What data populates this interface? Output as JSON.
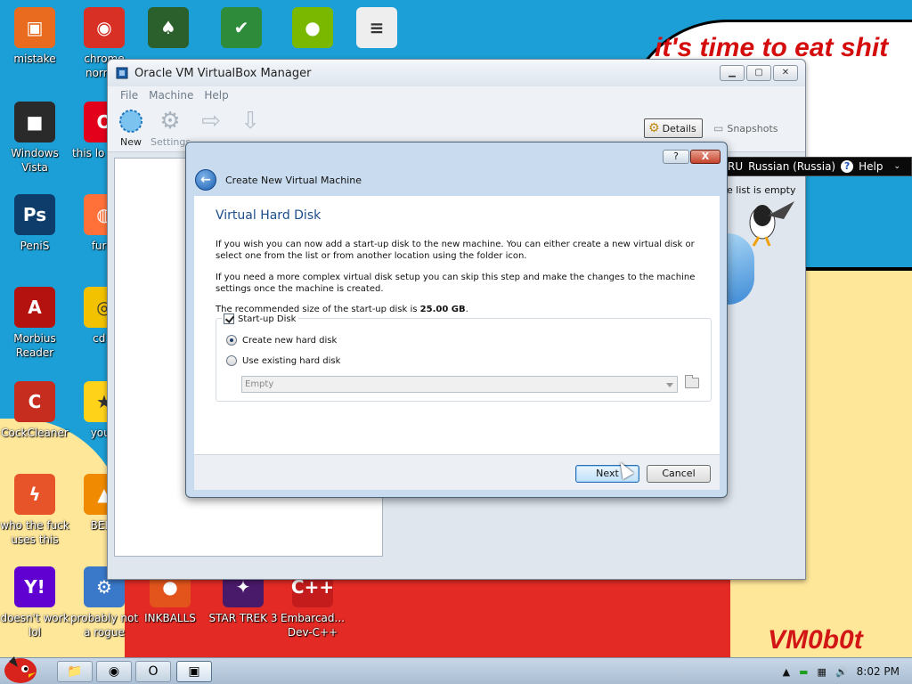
{
  "wallpaper": {
    "speech_text": "it's time to eat shit\nd chew\nm",
    "signature": "VM0b0t"
  },
  "desktop_icons": [
    {
      "name": "desktop-icon-mistake",
      "label": "mistake",
      "icon": "monitor-icon",
      "color": "#e86b1f"
    },
    {
      "name": "desktop-icon-chrome",
      "label": "chrome normal",
      "icon": "chrome-icon",
      "color": "#d93025"
    },
    {
      "name": "desktop-icon-solitaire",
      "label": "",
      "icon": "cards-icon",
      "color": "#2b5f2b"
    },
    {
      "name": "desktop-icon-shield",
      "label": "",
      "icon": "shield-icon",
      "color": "#2e8b3a"
    },
    {
      "name": "desktop-icon-angry-birds",
      "label": "",
      "icon": "pig-icon",
      "color": "#7ab800"
    },
    {
      "name": "desktop-icon-document",
      "label": "",
      "icon": "document-icon",
      "color": "#eeeeee"
    },
    {
      "name": "desktop-icon-windows-vista",
      "label": "Windows Vista",
      "icon": "trash-icon",
      "color": "#2a2a2a"
    },
    {
      "name": "desktop-icon-opera",
      "label": "this lo like a",
      "icon": "opera-icon",
      "color": "#e3001b"
    },
    {
      "name": "desktop-icon-photoshop",
      "label": "PeniS",
      "icon": "photoshop-icon",
      "color": "#0e3d6b"
    },
    {
      "name": "desktop-icon-firefox",
      "label": "furry",
      "icon": "firefox-icon",
      "color": "#ff7139"
    },
    {
      "name": "desktop-icon-reader",
      "label": "Morbius Reader",
      "icon": "pdf-icon",
      "color": "#b3120f"
    },
    {
      "name": "desktop-icon-cd",
      "label": "cd d",
      "icon": "cd-icon",
      "color": "#f2c200"
    },
    {
      "name": "desktop-icon-ccleaner",
      "label": "CockCleaner",
      "icon": "ccleaner-icon",
      "color": "#c62d1f"
    },
    {
      "name": "desktop-icon-star",
      "label": "you t",
      "icon": "star-icon",
      "color": "#ffd21a"
    },
    {
      "name": "desktop-icon-flash",
      "label": "who the fuck uses this",
      "icon": "flash-icon",
      "color": "#e8542a"
    },
    {
      "name": "desktop-icon-vlc",
      "label": "BEEP",
      "icon": "vlc-icon",
      "color": "#f08a00"
    },
    {
      "name": "desktop-icon-yahoo",
      "label": "doesn't work lol",
      "icon": "yahoo-icon",
      "color": "#6001d2"
    },
    {
      "name": "desktop-icon-programs",
      "label": "probably not a rogue",
      "icon": "gears-icon",
      "color": "#3a79c9"
    },
    {
      "name": "desktop-icon-inkball",
      "label": "INKBALLS",
      "icon": "inkball-icon",
      "color": "#e3541c"
    },
    {
      "name": "desktop-icon-star-trek",
      "label": "STAR TREK 3",
      "icon": "star-trek-icon",
      "color": "#4a1a6a"
    },
    {
      "name": "desktop-icon-devcpp",
      "label": "Embarcad... Dev-C++",
      "icon": "devcpp-icon",
      "color": "#c41c1c"
    }
  ],
  "vbox_manager": {
    "title": "Oracle VM VirtualBox Manager",
    "menu": [
      "File",
      "Machine",
      "Help"
    ],
    "toolbar": {
      "new_label": "New",
      "settings_label": "Settings",
      "details_label": "Details",
      "snapshots_label": "Snapshots"
    }
  },
  "language_bar": {
    "lang_code": "RU",
    "lang_name": "Russian (Russia)",
    "help_label": "Help"
  },
  "vm_list_empty": "e list is empty",
  "wizard": {
    "header_title": "Create New Virtual Machine",
    "help_button": "?",
    "close_button": "X",
    "page_title": "Virtual Hard Disk",
    "para1": "If you wish you can now add a start-up disk to the new machine. You can either create a new virtual disk or select one from the list or from another location using the folder icon.",
    "para2": "If you need a more complex virtual disk setup you can skip this step and make the changes to the machine settings once the machine is created.",
    "recommended_prefix": "The recommended size of the start-up disk is ",
    "recommended_size": "25.00 GB",
    "recommended_suffix": ".",
    "startup_disk_label": "Start-up Disk",
    "startup_disk_checked": true,
    "option_create": "Create new hard disk",
    "option_existing": "Use existing hard disk",
    "selected_option": "create",
    "disk_combo_value": "Empty",
    "next_label": "Next",
    "cancel_label": "Cancel"
  },
  "taskbar": {
    "buttons": [
      {
        "name": "taskbar-explorer-button",
        "icon": "folder-icon",
        "glyph": "📁"
      },
      {
        "name": "taskbar-chrome-button",
        "icon": "chrome-icon",
        "glyph": "◉"
      },
      {
        "name": "taskbar-opera-button",
        "icon": "opera-icon",
        "glyph": "O"
      },
      {
        "name": "taskbar-virtualbox-button",
        "icon": "virtualbox-icon",
        "glyph": "▣"
      }
    ],
    "clock": "8:02 PM"
  }
}
